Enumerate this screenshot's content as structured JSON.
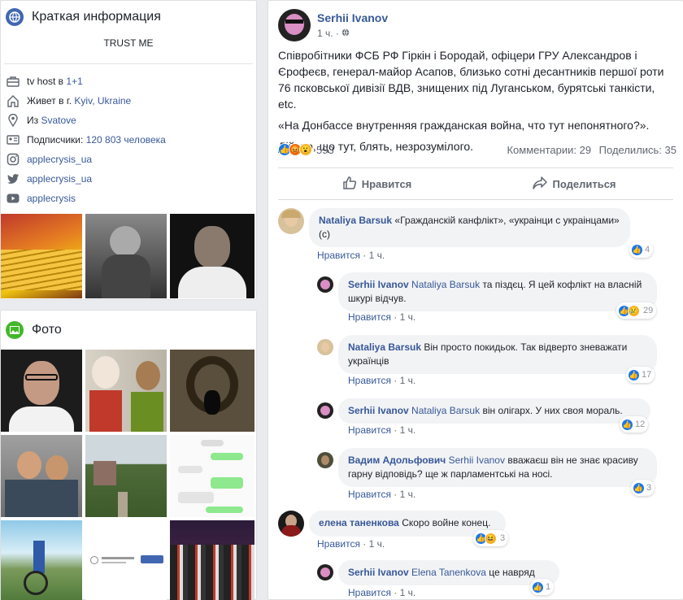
{
  "intro": {
    "title": "Краткая информация",
    "bio": "TRUST ME",
    "rows": [
      {
        "icon": "briefcase-icon",
        "pre": "tv host в ",
        "link": "1+1"
      },
      {
        "icon": "home-icon",
        "pre": "Живет в г. ",
        "link": "Kyiv, Ukraine"
      },
      {
        "icon": "location-pin-icon",
        "pre": "Из ",
        "link": "Svatove"
      },
      {
        "icon": "followers-icon",
        "pre": "Подписчики: ",
        "link": "120 803 человека"
      },
      {
        "icon": "instagram-icon",
        "pre": "",
        "link": "applecrysis_ua"
      },
      {
        "icon": "twitter-icon",
        "pre": "",
        "link": "applecrysis_ua"
      },
      {
        "icon": "youtube-icon",
        "pre": "",
        "link": "applecrysis"
      }
    ]
  },
  "photos": {
    "title": "Фото"
  },
  "post": {
    "author": "Serhii Ivanov",
    "time": "1 ч.",
    "paragraphs": [
      "Співробітники ФСБ РФ Гіркін і Бородай, офіцери ГРУ Александров і Єрофеєв, генерал-майор Асапов, близько сотні десантників першої роти 76 псковської дивізії ВДВ, знищених під Луганськом, бурятські танкісти, etc.",
      "«На Донбассе внутренняя гражданская война, что тут непонятного?».",
      "Дійсно, що тут, блять, незрозумілого."
    ],
    "reaction_count": "593",
    "comments_count": "Комментарии: 29",
    "shares_count": "Поделились: 35",
    "like_label": "Нравится",
    "share_label": "Поделиться"
  },
  "comments": [
    {
      "name": "Nataliya Barsuk",
      "tag": "",
      "text": "«Гражданскій канфлікт», «украінци с украінцами» (с)",
      "like": "Нравится",
      "time": "1 ч.",
      "count": "4"
    },
    {
      "name": "Serhii Ivanov",
      "tag": "Nataliya Barsuk",
      "text": "та піздєц. Я цей кофлікт на власній шкурі відчув.",
      "like": "Нравится",
      "time": "1 ч.",
      "count": "29"
    },
    {
      "name": "Nataliya Barsuk",
      "tag": "",
      "text": "Він просто покидьок. Так відверто зневажати українців",
      "like": "Нравится",
      "time": "1 ч.",
      "count": "17"
    },
    {
      "name": "Serhii Ivanov",
      "tag": "Nataliya Barsuk",
      "text": "він олігарх. У них своя мораль.",
      "like": "Нравится",
      "time": "1 ч.",
      "count": "12"
    },
    {
      "name": "Вадим Адольфович",
      "tag": "Serhii Ivanov",
      "text": "вважаєш він не знає красиву гарну відповідь? ще ж парламентські на носі.",
      "like": "Нравится",
      "time": "1 ч.",
      "count": "3"
    },
    {
      "name": "елена таненкова",
      "tag": "",
      "text": "Скоро войне конец.",
      "like": "Нравится",
      "time": "1 ч.",
      "count": "3"
    },
    {
      "name": "Serhii Ivanov",
      "tag": "Elena Tanenkova",
      "text": "це навряд",
      "like": "Нравится",
      "time": "1 ч.",
      "count": "1"
    }
  ]
}
